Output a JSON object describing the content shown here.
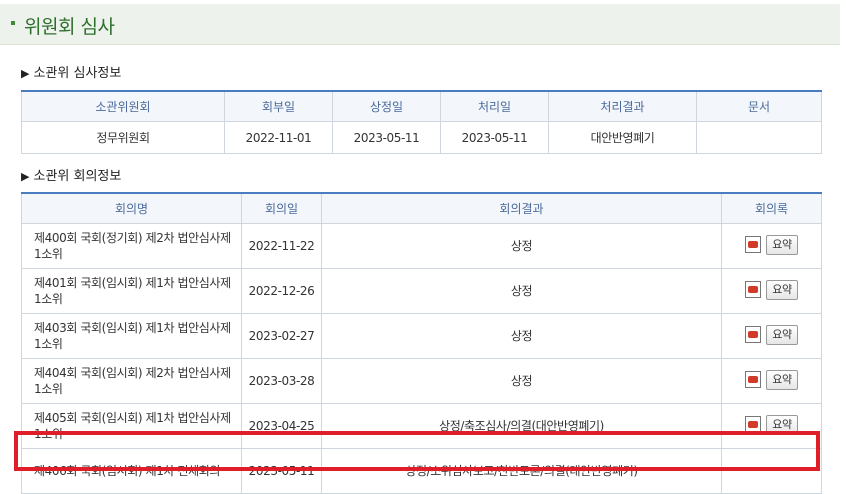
{
  "page": {
    "title": "위원회 심사"
  },
  "sections": {
    "review_info": "소관위 심사정보",
    "meeting_info": "소관위 회의정보"
  },
  "review_table": {
    "headers": [
      "소관위원회",
      "회부일",
      "상정일",
      "처리일",
      "처리결과",
      "문서"
    ],
    "row": [
      "정무위원회",
      "2022-11-01",
      "2023-05-11",
      "2023-05-11",
      "대안반영폐기",
      ""
    ]
  },
  "meeting_table": {
    "headers": [
      "회의명",
      "회의일",
      "회의결과",
      "회의록"
    ],
    "summary_label": "요약",
    "rows": [
      {
        "name": "제400회 국회(정기회) 제2차 법안심사제1소위",
        "date": "2022-11-22",
        "result": "상정"
      },
      {
        "name": "제401회 국회(임시회) 제1차 법안심사제1소위",
        "date": "2022-12-26",
        "result": "상정"
      },
      {
        "name": "제403회 국회(임시회) 제1차 법안심사제1소위",
        "date": "2023-02-27",
        "result": "상정"
      },
      {
        "name": "제404회 국회(임시회) 제2차 법안심사제1소위",
        "date": "2023-03-28",
        "result": "상정"
      },
      {
        "name": "제405회 국회(임시회) 제1차 법안심사제1소위",
        "date": "2023-04-25",
        "result": "상정/축조심사/의결(대안반영폐기)"
      },
      {
        "name": "제406회 국회(임시회) 제1차 전체회의",
        "date": "2023-05-11",
        "result": "상정/소위심사보고/찬반토론/의결(대안반영폐기)"
      }
    ]
  },
  "colors": {
    "accent": "#2f6f2c",
    "header_border": "#4a7cc0",
    "highlight": "#e01e2a"
  }
}
